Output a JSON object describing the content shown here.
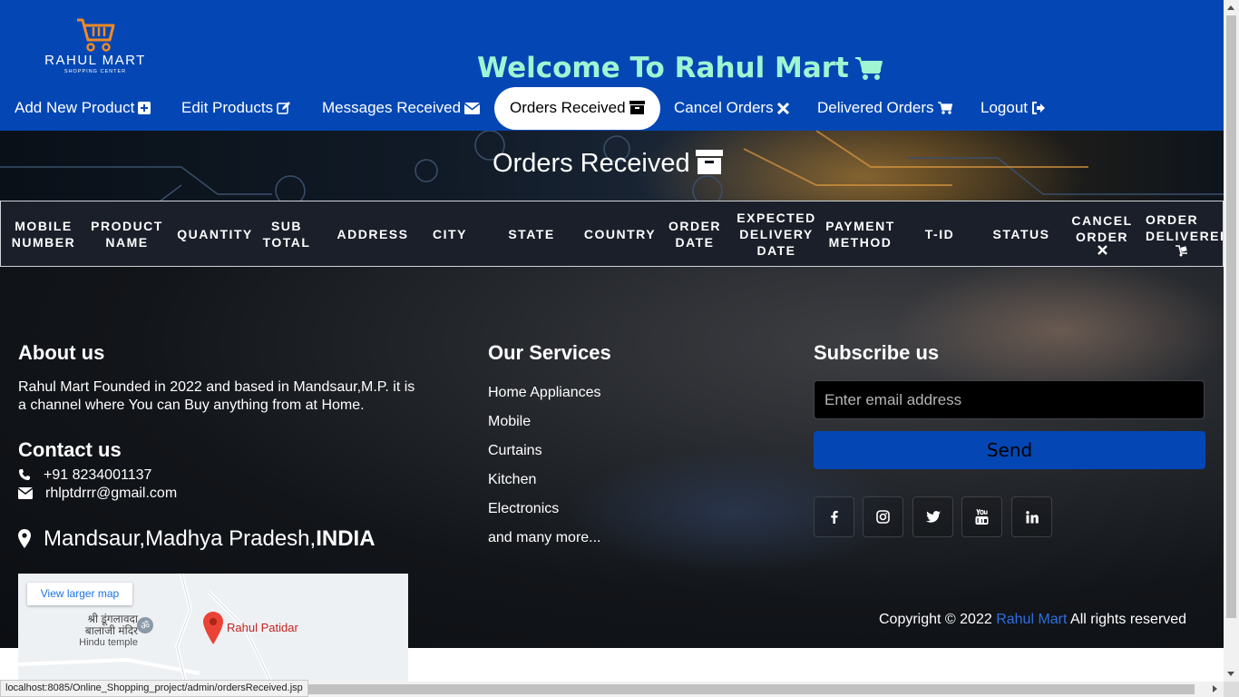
{
  "logo": {
    "name": "RAHUL MART",
    "tagline": "SHOPPING CENTER"
  },
  "header": {
    "welcome": "Welcome To Rahul Mart",
    "welcome_icon": "cart-icon"
  },
  "nav": {
    "items": [
      {
        "label": "Add New Product",
        "icon": "plus-square-icon"
      },
      {
        "label": "Edit Products",
        "icon": "edit-icon"
      },
      {
        "label": "Messages Received",
        "icon": "envelope-icon"
      },
      {
        "label": "Orders Received",
        "icon": "archive-icon",
        "active": true
      },
      {
        "label": "Cancel Orders",
        "icon": "times-icon"
      },
      {
        "label": "Delivered Orders",
        "icon": "cart-icon"
      },
      {
        "label": "Logout",
        "icon": "sign-out-icon"
      }
    ]
  },
  "page": {
    "heading": "Orders Received",
    "heading_icon": "archive-icon"
  },
  "table": {
    "columns": [
      "MOBILE NUMBER",
      "PRODUCT NAME",
      "QUANTITY",
      "SUB TOTAL",
      "ADDRESS",
      "CITY",
      "STATE",
      "COUNTRY",
      "ORDER DATE",
      "EXPECTED DELIVERY DATE",
      "PAYMENT METHOD",
      "T-ID",
      "STATUS",
      "CANCEL ORDER",
      "ORDER DELIVERED"
    ],
    "rows": []
  },
  "footer": {
    "about_title": "About us",
    "about_text": "Rahul Mart Founded in 2022 and based in Mandsaur,M.P. it is a channel where You can Buy anything from at Home.",
    "contact_title": "Contact us",
    "phone": "+91 8234001137",
    "email": "rhlptdrrr@gmail.com",
    "location_prefix": "Mandsaur,Madhya Pradesh,",
    "location_country": "INDIA",
    "services_title": "Our Services",
    "services": [
      "Home Appliances",
      "Mobile",
      "Curtains",
      "Kitchen",
      "Electronics",
      "and many more..."
    ],
    "subscribe_title": "Subscribe us",
    "email_placeholder": "Enter email address",
    "send_label": "Send",
    "social": [
      "facebook-icon",
      "instagram-icon",
      "twitter-icon",
      "youtube-icon",
      "linkedin-icon"
    ],
    "copyright_prefix": "Copyright © 2022",
    "copyright_brand": "Rahul Mart",
    "copyright_suffix": "All rights reserved"
  },
  "map": {
    "larger_link": "View larger map",
    "temple_name": "श्री डूंगलावदा बालाजी मंदिर",
    "temple_type": "Hindu temple",
    "pin_label": "Rahul Patidar"
  },
  "statusbar": {
    "url": "localhost:8085/Online_Shopping_project/admin/ordersReceived.jsp"
  },
  "colors": {
    "header_bg": "#0447b4",
    "welcome": "#9ff5d2",
    "table_header_bg": "#1b1f2a",
    "link_brand": "#2d6fe0"
  }
}
